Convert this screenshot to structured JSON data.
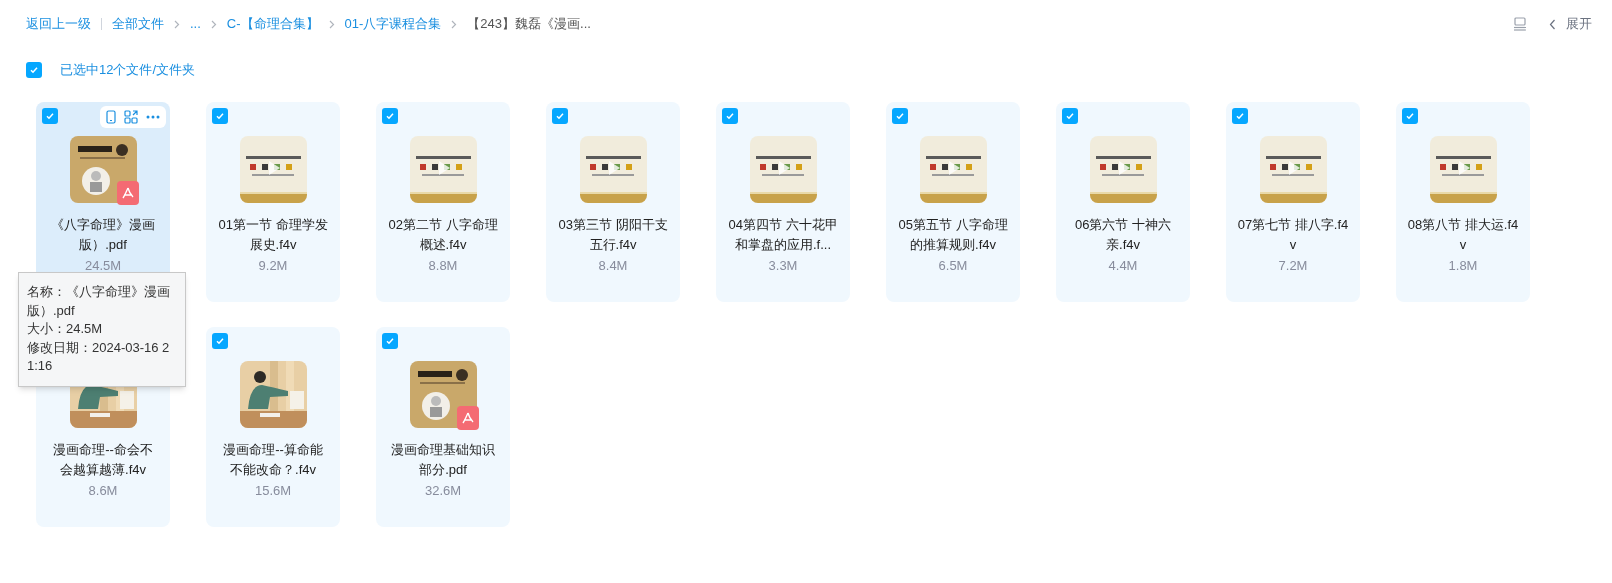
{
  "breadcrumb": {
    "back": "返回上一级",
    "items": [
      {
        "label": "全部文件",
        "kind": "link"
      },
      {
        "label": "...",
        "kind": "link"
      },
      {
        "label": "C-【命理合集】",
        "kind": "link"
      },
      {
        "label": "01-八字课程合集",
        "kind": "link"
      },
      {
        "label": "【243】魏磊《漫画...",
        "kind": "current"
      }
    ]
  },
  "toolbar": {
    "expand_label": "展开"
  },
  "selection": {
    "checked": true,
    "label": "已选中12个文件/文件夹"
  },
  "files": [
    {
      "name": "《八字命理》漫画版）.pdf",
      "size": "24.5M",
      "kind": "pdf",
      "checked": true,
      "hovered": true
    },
    {
      "name": "01第一节 命理学发展史.f4v",
      "size": "9.2M",
      "kind": "video",
      "checked": true,
      "hovered": false
    },
    {
      "name": "02第二节 八字命理概述.f4v",
      "size": "8.8M",
      "kind": "video",
      "checked": true,
      "hovered": false
    },
    {
      "name": "03第三节 阴阳干支五行.f4v",
      "size": "8.4M",
      "kind": "video",
      "checked": true,
      "hovered": false
    },
    {
      "name": "04第四节 六十花甲和掌盘的应用.f...",
      "size": "3.3M",
      "kind": "video",
      "checked": true,
      "hovered": false
    },
    {
      "name": "05第五节 八字命理的推算规则.f4v",
      "size": "6.5M",
      "kind": "video",
      "checked": true,
      "hovered": false
    },
    {
      "name": "06第六节 十神六亲.f4v",
      "size": "4.4M",
      "kind": "video",
      "checked": true,
      "hovered": false
    },
    {
      "name": "07第七节 排八字.f4v",
      "size": "7.2M",
      "kind": "video",
      "checked": true,
      "hovered": false
    },
    {
      "name": "08第八节 排大运.f4v",
      "size": "1.8M",
      "kind": "video",
      "checked": true,
      "hovered": false
    },
    {
      "name": "漫画命理--命会不会越算越薄.f4v",
      "size": "8.6M",
      "hovered": false
    },
    {
      "name": "漫画命理--算命能不能改命？.f4v",
      "size": "15.6M",
      "checked": true,
      "hovered": false
    },
    {
      "name": "漫画命理基础知识部分.pdf",
      "size": "32.6M",
      "kind": "pdf",
      "checked": true,
      "hovered": false
    }
  ],
  "tooltip": {
    "lines": [
      "名称：《八字命理》漫画版）.pdf",
      "大小：24.5M",
      "修改日期：2024-03-16 21:16"
    ]
  }
}
